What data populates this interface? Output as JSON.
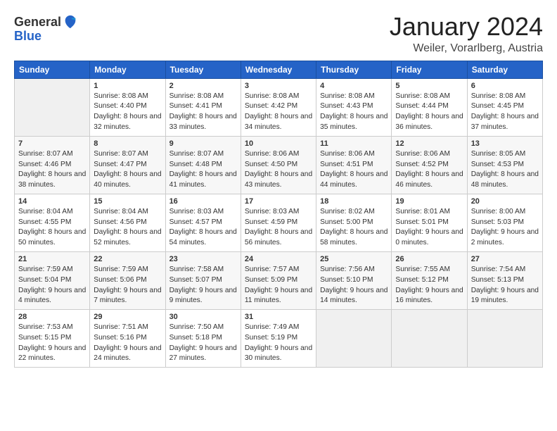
{
  "logo": {
    "general": "General",
    "blue": "Blue"
  },
  "title": "January 2024",
  "location": "Weiler, Vorarlberg, Austria",
  "days_of_week": [
    "Sunday",
    "Monday",
    "Tuesday",
    "Wednesday",
    "Thursday",
    "Friday",
    "Saturday"
  ],
  "weeks": [
    [
      {
        "day": "",
        "sunrise": "",
        "sunset": "",
        "daylight": ""
      },
      {
        "day": "1",
        "sunrise": "Sunrise: 8:08 AM",
        "sunset": "Sunset: 4:40 PM",
        "daylight": "Daylight: 8 hours and 32 minutes."
      },
      {
        "day": "2",
        "sunrise": "Sunrise: 8:08 AM",
        "sunset": "Sunset: 4:41 PM",
        "daylight": "Daylight: 8 hours and 33 minutes."
      },
      {
        "day": "3",
        "sunrise": "Sunrise: 8:08 AM",
        "sunset": "Sunset: 4:42 PM",
        "daylight": "Daylight: 8 hours and 34 minutes."
      },
      {
        "day": "4",
        "sunrise": "Sunrise: 8:08 AM",
        "sunset": "Sunset: 4:43 PM",
        "daylight": "Daylight: 8 hours and 35 minutes."
      },
      {
        "day": "5",
        "sunrise": "Sunrise: 8:08 AM",
        "sunset": "Sunset: 4:44 PM",
        "daylight": "Daylight: 8 hours and 36 minutes."
      },
      {
        "day": "6",
        "sunrise": "Sunrise: 8:08 AM",
        "sunset": "Sunset: 4:45 PM",
        "daylight": "Daylight: 8 hours and 37 minutes."
      }
    ],
    [
      {
        "day": "7",
        "sunrise": "Sunrise: 8:07 AM",
        "sunset": "Sunset: 4:46 PM",
        "daylight": "Daylight: 8 hours and 38 minutes."
      },
      {
        "day": "8",
        "sunrise": "Sunrise: 8:07 AM",
        "sunset": "Sunset: 4:47 PM",
        "daylight": "Daylight: 8 hours and 40 minutes."
      },
      {
        "day": "9",
        "sunrise": "Sunrise: 8:07 AM",
        "sunset": "Sunset: 4:48 PM",
        "daylight": "Daylight: 8 hours and 41 minutes."
      },
      {
        "day": "10",
        "sunrise": "Sunrise: 8:06 AM",
        "sunset": "Sunset: 4:50 PM",
        "daylight": "Daylight: 8 hours and 43 minutes."
      },
      {
        "day": "11",
        "sunrise": "Sunrise: 8:06 AM",
        "sunset": "Sunset: 4:51 PM",
        "daylight": "Daylight: 8 hours and 44 minutes."
      },
      {
        "day": "12",
        "sunrise": "Sunrise: 8:06 AM",
        "sunset": "Sunset: 4:52 PM",
        "daylight": "Daylight: 8 hours and 46 minutes."
      },
      {
        "day": "13",
        "sunrise": "Sunrise: 8:05 AM",
        "sunset": "Sunset: 4:53 PM",
        "daylight": "Daylight: 8 hours and 48 minutes."
      }
    ],
    [
      {
        "day": "14",
        "sunrise": "Sunrise: 8:04 AM",
        "sunset": "Sunset: 4:55 PM",
        "daylight": "Daylight: 8 hours and 50 minutes."
      },
      {
        "day": "15",
        "sunrise": "Sunrise: 8:04 AM",
        "sunset": "Sunset: 4:56 PM",
        "daylight": "Daylight: 8 hours and 52 minutes."
      },
      {
        "day": "16",
        "sunrise": "Sunrise: 8:03 AM",
        "sunset": "Sunset: 4:57 PM",
        "daylight": "Daylight: 8 hours and 54 minutes."
      },
      {
        "day": "17",
        "sunrise": "Sunrise: 8:03 AM",
        "sunset": "Sunset: 4:59 PM",
        "daylight": "Daylight: 8 hours and 56 minutes."
      },
      {
        "day": "18",
        "sunrise": "Sunrise: 8:02 AM",
        "sunset": "Sunset: 5:00 PM",
        "daylight": "Daylight: 8 hours and 58 minutes."
      },
      {
        "day": "19",
        "sunrise": "Sunrise: 8:01 AM",
        "sunset": "Sunset: 5:01 PM",
        "daylight": "Daylight: 9 hours and 0 minutes."
      },
      {
        "day": "20",
        "sunrise": "Sunrise: 8:00 AM",
        "sunset": "Sunset: 5:03 PM",
        "daylight": "Daylight: 9 hours and 2 minutes."
      }
    ],
    [
      {
        "day": "21",
        "sunrise": "Sunrise: 7:59 AM",
        "sunset": "Sunset: 5:04 PM",
        "daylight": "Daylight: 9 hours and 4 minutes."
      },
      {
        "day": "22",
        "sunrise": "Sunrise: 7:59 AM",
        "sunset": "Sunset: 5:06 PM",
        "daylight": "Daylight: 9 hours and 7 minutes."
      },
      {
        "day": "23",
        "sunrise": "Sunrise: 7:58 AM",
        "sunset": "Sunset: 5:07 PM",
        "daylight": "Daylight: 9 hours and 9 minutes."
      },
      {
        "day": "24",
        "sunrise": "Sunrise: 7:57 AM",
        "sunset": "Sunset: 5:09 PM",
        "daylight": "Daylight: 9 hours and 11 minutes."
      },
      {
        "day": "25",
        "sunrise": "Sunrise: 7:56 AM",
        "sunset": "Sunset: 5:10 PM",
        "daylight": "Daylight: 9 hours and 14 minutes."
      },
      {
        "day": "26",
        "sunrise": "Sunrise: 7:55 AM",
        "sunset": "Sunset: 5:12 PM",
        "daylight": "Daylight: 9 hours and 16 minutes."
      },
      {
        "day": "27",
        "sunrise": "Sunrise: 7:54 AM",
        "sunset": "Sunset: 5:13 PM",
        "daylight": "Daylight: 9 hours and 19 minutes."
      }
    ],
    [
      {
        "day": "28",
        "sunrise": "Sunrise: 7:53 AM",
        "sunset": "Sunset: 5:15 PM",
        "daylight": "Daylight: 9 hours and 22 minutes."
      },
      {
        "day": "29",
        "sunrise": "Sunrise: 7:51 AM",
        "sunset": "Sunset: 5:16 PM",
        "daylight": "Daylight: 9 hours and 24 minutes."
      },
      {
        "day": "30",
        "sunrise": "Sunrise: 7:50 AM",
        "sunset": "Sunset: 5:18 PM",
        "daylight": "Daylight: 9 hours and 27 minutes."
      },
      {
        "day": "31",
        "sunrise": "Sunrise: 7:49 AM",
        "sunset": "Sunset: 5:19 PM",
        "daylight": "Daylight: 9 hours and 30 minutes."
      },
      {
        "day": "",
        "sunrise": "",
        "sunset": "",
        "daylight": ""
      },
      {
        "day": "",
        "sunrise": "",
        "sunset": "",
        "daylight": ""
      },
      {
        "day": "",
        "sunrise": "",
        "sunset": "",
        "daylight": ""
      }
    ]
  ]
}
